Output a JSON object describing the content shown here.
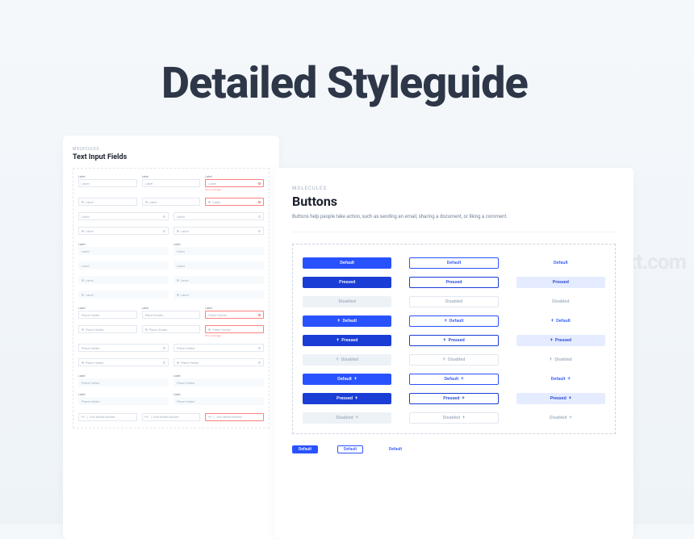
{
  "hero": {
    "title": "Detailed Styleguide"
  },
  "watermark": "xt.com",
  "left": {
    "overline": "MOLECULES",
    "title": "Text Input Fields",
    "labels": {
      "label": "Label",
      "placeholder": "Place Holder",
      "error": "Error message",
      "phone_placeholder": "Your Mobile Number",
      "country_code": "+91"
    }
  },
  "right": {
    "overline": "MOLECULES",
    "title": "Buttons",
    "description": "Buttons help people take action, such as sending an email, sharing a document, or liking a comment.",
    "states": {
      "default": "Default",
      "pressed": "Pressed",
      "disabled": "Disabled"
    }
  }
}
